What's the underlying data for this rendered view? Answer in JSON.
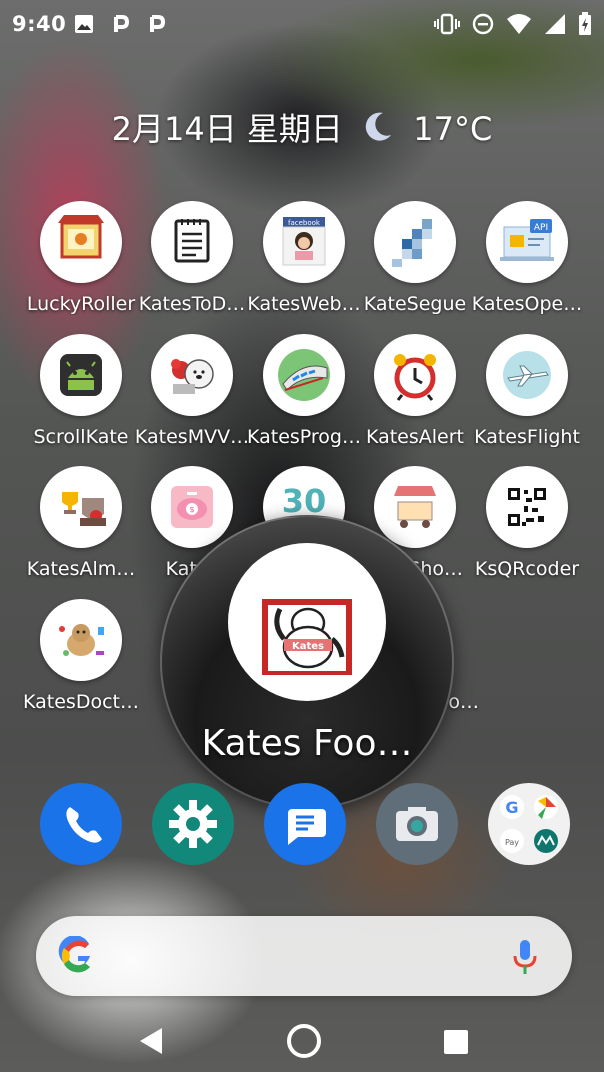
{
  "status_bar": {
    "time": "9:40",
    "left_icons": [
      "image-icon",
      "p-icon",
      "p-icon"
    ],
    "right_icons": [
      "vibrate-icon",
      "dnd-icon",
      "wifi-icon",
      "signal-icon",
      "battery-charging-icon"
    ]
  },
  "widget": {
    "date": "2月14日 星期日",
    "weather_icon": "moon-icon",
    "temperature": "17°C"
  },
  "apps": [
    {
      "label": "LuckyRoller",
      "icon": "lucky-roller-icon"
    },
    {
      "label": "KatesToD…",
      "icon": "todo-notepad-icon"
    },
    {
      "label": "KatesWeb…",
      "icon": "facebook-profile-icon"
    },
    {
      "label": "KateSegue",
      "icon": "segue-blocks-icon"
    },
    {
      "label": "KatesOpe…",
      "icon": "api-icon"
    },
    {
      "label": "ScrollKate",
      "icon": "android-robot-icon"
    },
    {
      "label": "KatesMVV…",
      "icon": "bear-icon"
    },
    {
      "label": "KatesProg…",
      "icon": "train-icon"
    },
    {
      "label": "KatesAlert",
      "icon": "alarm-clock-icon"
    },
    {
      "label": "KatesFlight",
      "icon": "airplane-icon"
    },
    {
      "label": "KatesAlm…",
      "icon": "trophy-icon"
    },
    {
      "label": "Kates",
      "icon": "piggy-bank-icon"
    },
    {
      "label": "",
      "icon": "thirty-icon"
    },
    {
      "label": "Sho…",
      "icon": "shop-stall-icon"
    },
    {
      "label": "KsQRcoder",
      "icon": "qr-code-icon"
    },
    {
      "label": "KatesDoct…",
      "icon": "doctor-dog-icon"
    },
    {
      "label": "o…",
      "icon": "partial-app-icon"
    }
  ],
  "magnifier": {
    "label": "Kates Foo…",
    "icon": "kates-food-icon",
    "icon_text": "Kates"
  },
  "dock": [
    {
      "name": "phone",
      "icon": "phone-icon",
      "color": "#1a73e8"
    },
    {
      "name": "settings",
      "icon": "gear-icon",
      "color": "#12887a"
    },
    {
      "name": "messages",
      "icon": "message-icon",
      "color": "#1a73e8"
    },
    {
      "name": "camera",
      "icon": "camera-icon",
      "color": "#5f6e78"
    },
    {
      "name": "google-folder",
      "icon": "google-apps-folder-icon",
      "color": "#f1f1f1"
    }
  ],
  "search": {
    "google_logo": "G",
    "mic_icon": "mic-icon"
  },
  "nav": [
    "back-icon",
    "home-icon",
    "recents-icon"
  ]
}
